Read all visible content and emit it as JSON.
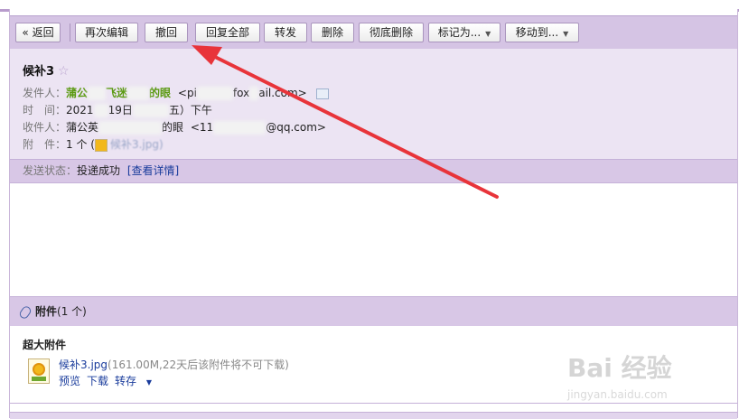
{
  "toolbar": {
    "back": "« 返回",
    "reedit": "再次编辑",
    "recall": "撤回",
    "reply_all": "回复全部",
    "forward": "转发",
    "delete": "删除",
    "delete_forever": "彻底删除",
    "mark_as": "标记为...",
    "move_to": "移动到..."
  },
  "mail": {
    "subject": "候补3",
    "star": "☆",
    "from_label": "发件人：",
    "from_name_a": "蒲公",
    "from_name_b": "飞迷",
    "from_name_c": "的眼",
    "from_email_a": "<pi",
    "from_email_b": "fox",
    "from_email_c": "ail.com>",
    "time_label": "时　间：",
    "time_a": "2021",
    "time_b": "19日",
    "time_c": "五）下午",
    "to_label": "收件人：",
    "to_name_a": "蒲公英",
    "to_name_b": "的眼",
    "to_email_a": "<11",
    "to_email_b": "@qq.com>",
    "attach_label": "附　件：",
    "attach_value": "1 个 (",
    "attach_file": "候补3.jpg)"
  },
  "send_status": {
    "label": "发送状态：",
    "value": "投递成功",
    "link": "[查看详情]"
  },
  "attachments": {
    "title": "附件",
    "count": "(1 个)",
    "section": "超大附件",
    "file_name": "候补3.jpg",
    "file_meta": "(161.00M,22天后该附件将不可下载)",
    "preview": "预览",
    "download": "下载",
    "save": "转存"
  },
  "watermark": {
    "text": "Bai 经验",
    "url": "jingyan.baidu.com"
  },
  "colors": {
    "toolbar_bg": "#d5c4e4",
    "header_bg": "#ece4f3",
    "accent_link": "#1a3c9c",
    "sender_green": "#5b9a12",
    "annotation_red": "#e8343a"
  }
}
